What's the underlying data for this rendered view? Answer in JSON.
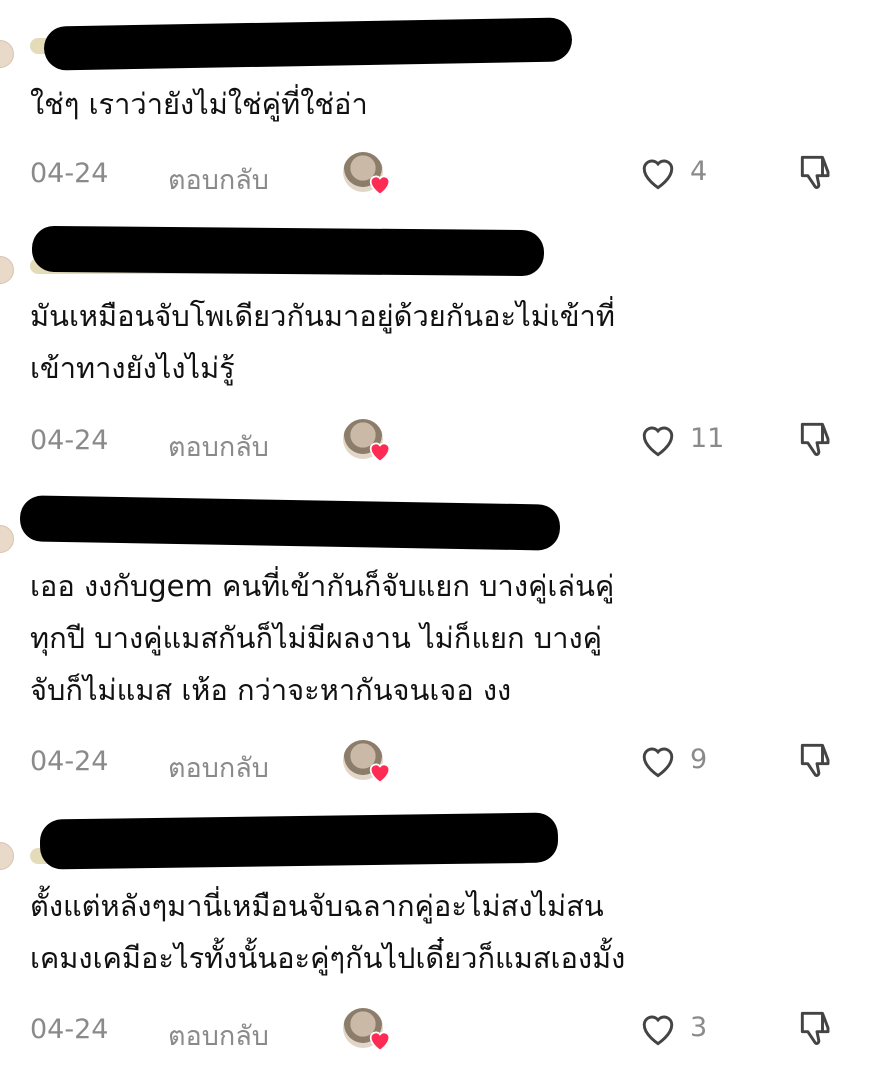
{
  "comments": [
    {
      "text": "ใช่ๆ เราว่ายังไม่ใช่คู่ที่ใช่อ่า",
      "date": "04-24",
      "reply_label": "ตอบกลับ",
      "likes": "4"
    },
    {
      "text": "มันเหมือนจับโพเดียวกันมาอยู่ด้วยกันอะไม่เข้าที่\nเข้าทางยังไงไม่รู้",
      "date": "04-24",
      "reply_label": "ตอบกลับ",
      "likes": "11"
    },
    {
      "text": "เออ งงกับgem คนที่เข้ากันก็จับแยก บางคู่เล่นคู่\nทุกปี บางคู่แมสกันก็ไม่มีผลงาน ไม่ก็แยก บางคู่\nจับก็ไม่แมส เห้อ กว่าจะหากันจนเจอ งง",
      "date": "04-24",
      "reply_label": "ตอบกลับ",
      "likes": "9"
    },
    {
      "text": "ตั้งแต่หลังๆมานี่เหมือนจับฉลากคู่อะไม่สงไม่สน\nเคมงเคมีอะไรทั้งนั้นอะคู่ๆกันไปเดี๋ยวก็แมสเองมั้ง",
      "date": "04-24",
      "reply_label": "ตอบกลับ",
      "likes": "3"
    }
  ],
  "icons": {
    "like": "heart-outline-icon",
    "dislike": "thumbs-down-outline-icon",
    "creator_liked": "heart-filled-icon"
  },
  "colors": {
    "meta_text": "#8a8a8a",
    "heart_red": "#fe2c55",
    "redaction": "#000000"
  }
}
